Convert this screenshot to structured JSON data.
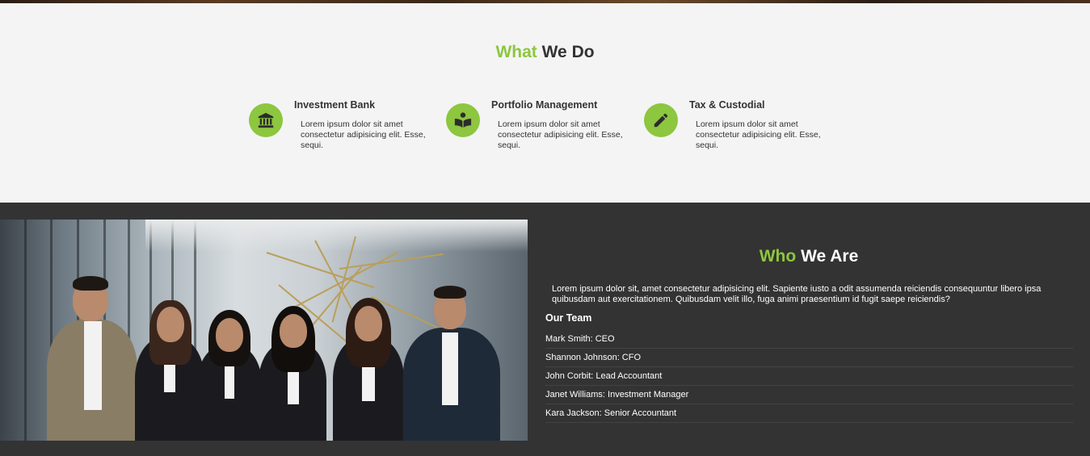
{
  "what_we_do": {
    "title_accent": "What",
    "title_rest": "We Do",
    "services": [
      {
        "icon": "bank-icon",
        "title": "Investment Bank",
        "text": "Lorem ipsum dolor sit amet consectetur adipisicing elit. Esse, sequi."
      },
      {
        "icon": "book-reader-icon",
        "title": "Portfolio Management",
        "text": "Lorem ipsum dolor sit amet consectetur adipisicing elit. Esse, sequi."
      },
      {
        "icon": "pencil-icon",
        "title": "Tax & Custodial",
        "text": "Lorem ipsum dolor sit amet consectetur adipisicing elit. Esse, sequi."
      }
    ]
  },
  "who_we_are": {
    "title_accent": "Who",
    "title_rest": "We Are",
    "text": "Lorem ipsum dolor sit, amet consectetur adipisicing elit. Sapiente iusto a odit assumenda reiciendis consequuntur libero ipsa quibusdam aut exercitationem. Quibusdam velit illo, fuga animi praesentium id fugit saepe reiciendis?",
    "team_title": "Our Team",
    "team": [
      "Mark Smith: CEO",
      "Shannon Johnson: CFO",
      "John Corbit: Lead Accountant",
      "Janet Williams: Investment Manager",
      "Kara Jackson: Senior Accountant"
    ]
  },
  "colors": {
    "accent": "#8dc63f",
    "dark_bg": "#333333",
    "light_bg": "#f4f4f4"
  }
}
